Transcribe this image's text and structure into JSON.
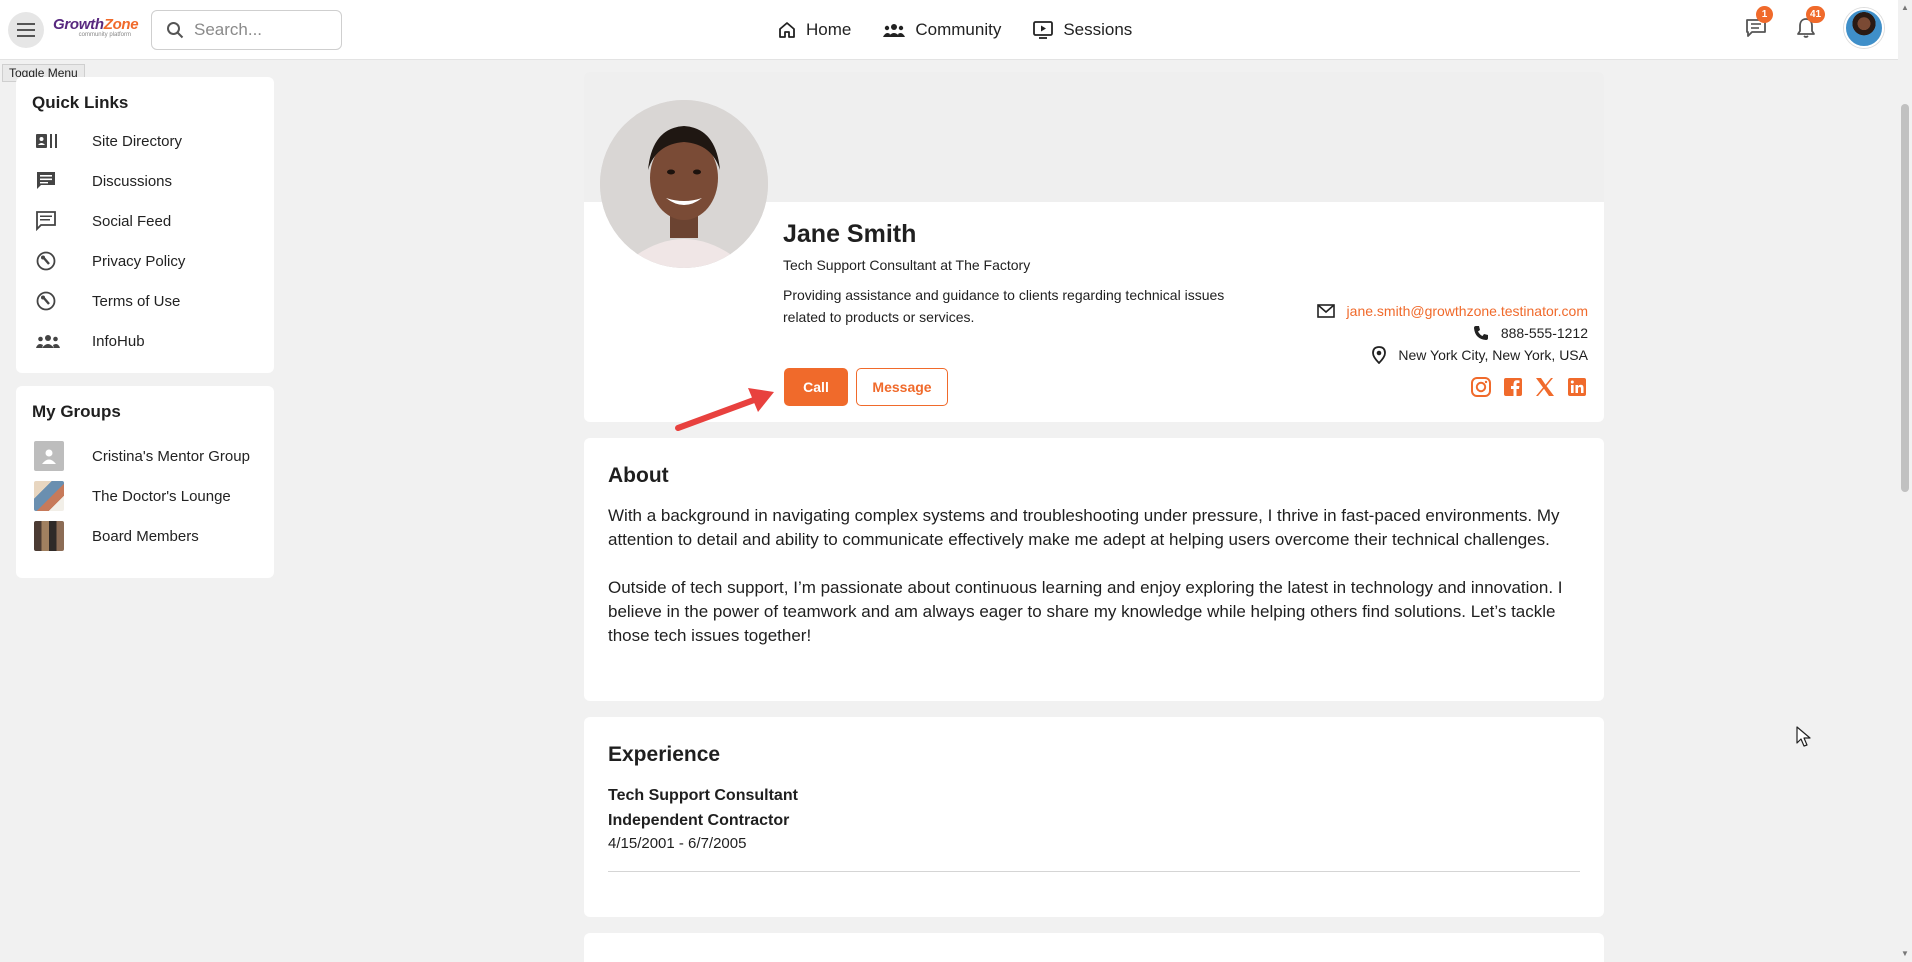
{
  "header": {
    "toggle_tooltip": "Toggle Menu",
    "logo_text": "GrowthZone",
    "logo_sub": "community platform",
    "search_placeholder": "Search...",
    "nav": [
      {
        "label": "Home",
        "icon": "home-icon"
      },
      {
        "label": "Community",
        "icon": "community-icon"
      },
      {
        "label": "Sessions",
        "icon": "sessions-icon"
      }
    ],
    "messages_badge": "1",
    "notifications_badge": "41"
  },
  "sidebar": {
    "quick_links_title": "Quick Links",
    "quick_links": [
      {
        "label": "Site Directory",
        "icon": "directory-icon"
      },
      {
        "label": "Discussions",
        "icon": "discussions-icon"
      },
      {
        "label": "Social Feed",
        "icon": "feed-icon"
      },
      {
        "label": "Privacy Policy",
        "icon": "wrench-icon"
      },
      {
        "label": "Terms of Use",
        "icon": "wrench-icon"
      },
      {
        "label": "InfoHub",
        "icon": "group-icon"
      }
    ],
    "groups_title": "My Groups",
    "groups": [
      {
        "label": "Cristina's Mentor Group"
      },
      {
        "label": "The Doctor's Lounge"
      },
      {
        "label": "Board Members"
      }
    ]
  },
  "profile": {
    "name": "Jane Smith",
    "title": "Tech Support Consultant at The Factory",
    "bio": "Providing assistance and guidance to clients regarding technical issues related to products or services.",
    "email": "jane.smith@growthzone.testinator.com",
    "phone": "888-555-1212",
    "location": "New York City, New York, USA",
    "call_label": "Call",
    "message_label": "Message"
  },
  "about": {
    "title": "About",
    "paragraphs": [
      "With a background in navigating complex systems and troubleshooting under pressure, I thrive in fast-paced environments. My attention to detail and ability to communicate effectively make me adept at helping users overcome their technical challenges.",
      "Outside of tech support, I’m passionate about continuous learning and enjoy exploring the latest in technology and innovation. I believe in the power of teamwork and am always eager to share my knowledge while helping others find solutions. Let’s tackle those tech issues together!"
    ]
  },
  "experience": {
    "title": "Experience",
    "items": [
      {
        "role": "Tech Support Consultant",
        "company": "Independent Contractor",
        "dates": "4/15/2001 - 6/7/2005"
      }
    ]
  },
  "colors": {
    "accent": "#f06a2b",
    "brand_purple": "#58287f",
    "background": "#f1f1f1"
  }
}
